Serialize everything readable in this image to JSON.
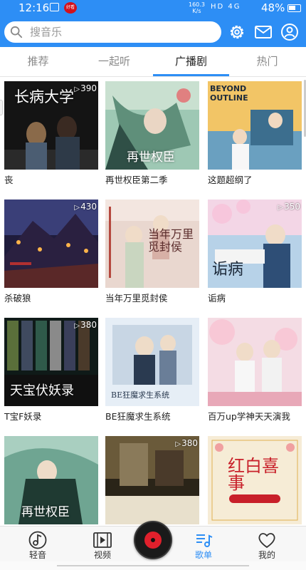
{
  "status_bar": {
    "time": "12:16",
    "app_badge": "好看",
    "net_speed_value": "160.3",
    "net_speed_unit": "K/s",
    "icons": "HD 4G",
    "battery": "48%"
  },
  "header": {
    "search_placeholder": "搜音乐",
    "settings_icon": "gear-icon",
    "message_icon": "mail-icon",
    "profile_icon": "user-icon",
    "colors": {
      "bar": "#2d8ef5",
      "accent": "#2d8ef5"
    }
  },
  "tabs": [
    {
      "label": "推荐",
      "active": false
    },
    {
      "label": "一起听",
      "active": false
    },
    {
      "label": "广播剧",
      "active": true
    },
    {
      "label": "热门",
      "active": false
    }
  ],
  "items": [
    {
      "title": "丧",
      "count": "390",
      "cover_text": "长病大学"
    },
    {
      "title": "再世权臣第二季",
      "count": "",
      "cover_text": "再世权臣"
    },
    {
      "title": "这题超纲了",
      "count": "",
      "cover_text": "BEYOND OUTLINE"
    },
    {
      "title": "杀破狼",
      "count": "430",
      "cover_text": ""
    },
    {
      "title": "当年万里觅封侯",
      "count": "",
      "cover_text": "当年万里觅封侯"
    },
    {
      "title": "诟病",
      "count": "350",
      "cover_text": "诟病"
    },
    {
      "title": "T宝F妖录",
      "count": "380",
      "cover_text": "天宝伏妖录"
    },
    {
      "title": "BE狂魔求生系统",
      "count": "",
      "cover_text": "BE狂魔求生系统"
    },
    {
      "title": "百万up学神天天演我",
      "count": "",
      "cover_text": ""
    },
    {
      "title": "",
      "count": "",
      "cover_text": "再世权臣"
    },
    {
      "title": "",
      "count": "380",
      "cover_text": ""
    },
    {
      "title": "",
      "count": "",
      "cover_text": "红白喜事"
    }
  ],
  "bottom_nav": [
    {
      "label": "轻音",
      "icon": "music-note-icon",
      "active": false
    },
    {
      "label": "视频",
      "icon": "film-icon",
      "active": false
    },
    {
      "label": "歌单",
      "icon": "playlist-icon",
      "active": true
    },
    {
      "label": "我的",
      "icon": "heart-icon",
      "active": false
    }
  ],
  "player": {
    "icon": "vinyl-disc-icon"
  }
}
